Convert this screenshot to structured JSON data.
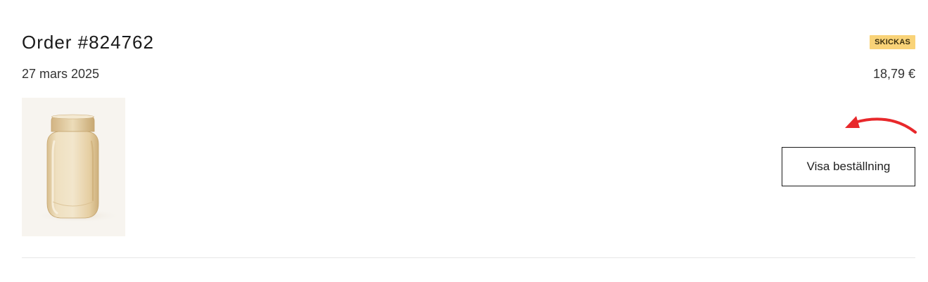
{
  "order": {
    "title": "Order #824762",
    "date": "27 mars 2025",
    "status": "SKICKAS",
    "status_color": "#f9d378",
    "total": "18,79 €",
    "view_button_label": "Visa beställning"
  },
  "product": {
    "icon": "glass-vase-image"
  },
  "annotation": {
    "icon": "red-curved-arrow-icon",
    "color": "#e8282b"
  }
}
